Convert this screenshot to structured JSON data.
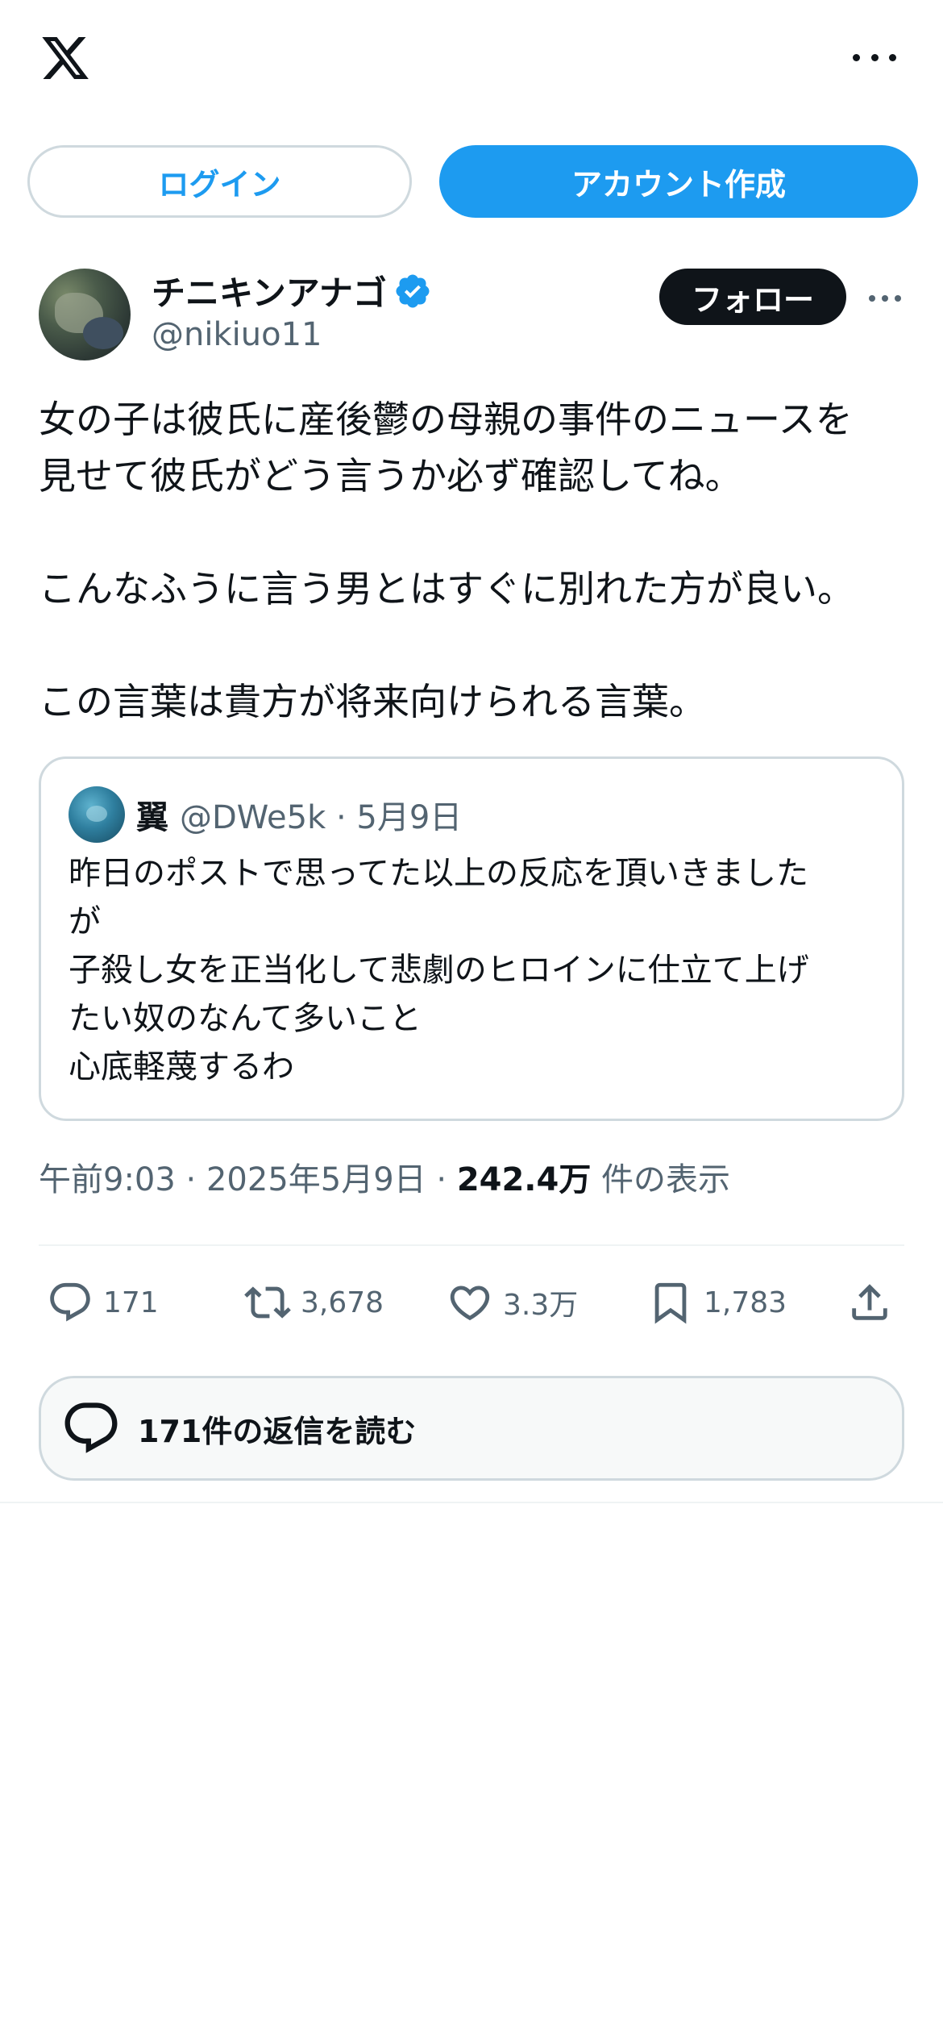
{
  "header": {
    "logo_icon": "x-logo-icon",
    "more_icon": "more-horizontal-icon"
  },
  "auth": {
    "login_label": "ログイン",
    "signup_label": "アカウント作成"
  },
  "post": {
    "author": {
      "display_name": "チニキンアナゴ",
      "handle": "@nikiuo11",
      "verified": true,
      "follow_label": "フォロー"
    },
    "text": "女の子は彼氏に産後鬱の母親の事件のニュースを\n見せて彼氏がどう言うか必ず確認してね。\n\nこんなふうに言う男とはすぐに別れた方が良い。\n\nこの言葉は貴方が将来向けられる言葉。",
    "quote": {
      "name": "翼",
      "handle": "@DWe5k · 5月9日",
      "text": "昨日のポストで思ってた以上の反応を頂いきました\nが\n子殺し女を正当化して悲劇のヒロインに仕立て上げ\nたい奴のなんて多いこと\n心底軽蔑するわ"
    },
    "meta": {
      "time_date": "午前9:03 · 2025年5月9日 · ",
      "views_count": "242.4万",
      "views_label": " 件の表示"
    },
    "actions": {
      "replies": "171",
      "reposts": "3,678",
      "likes": "3.3万",
      "bookmarks": "1,783"
    },
    "read_replies_label": "171件の返信を読む"
  },
  "colors": {
    "accent": "#1d9bf0",
    "text": "#0f1419",
    "secondary": "#536471",
    "border": "#cfd9de"
  }
}
